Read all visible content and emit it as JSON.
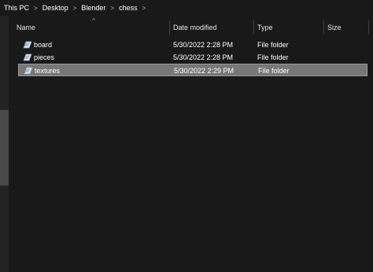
{
  "breadcrumb": [
    "This PC",
    "Desktop",
    "Blender",
    "chess"
  ],
  "breadcrumb_separator": ">",
  "columns": {
    "name": "Name",
    "date": "Date modified",
    "type": "Type",
    "size": "Size"
  },
  "sort_indicator": "^",
  "files": [
    {
      "name": "board",
      "date": "5/30/2022 2:28 PM",
      "type": "File folder",
      "selected": false
    },
    {
      "name": "pieces",
      "date": "5/30/2022 2:28 PM",
      "type": "File folder",
      "selected": false
    },
    {
      "name": "textures",
      "date": "5/30/2022 2:29 PM",
      "type": "File folder",
      "selected": true
    }
  ]
}
